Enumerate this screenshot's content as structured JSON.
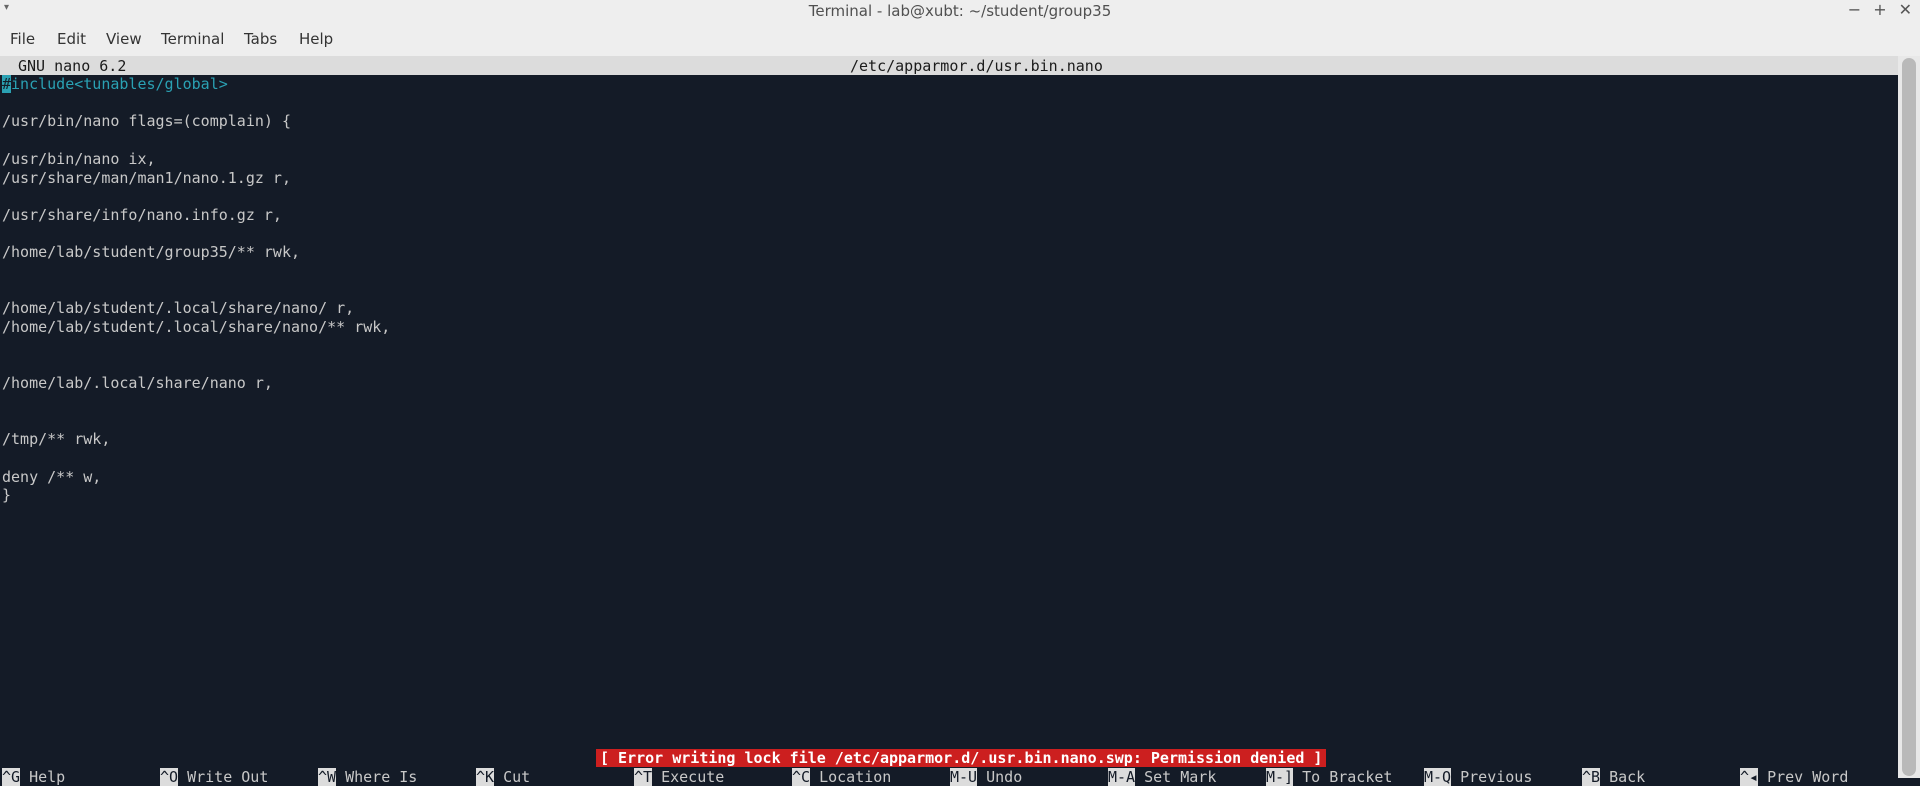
{
  "window": {
    "title": "Terminal - lab@xubt: ~/student/group35",
    "controls": [
      "minimize-icon",
      "maximize-icon",
      "close-icon"
    ]
  },
  "menubar": [
    "File",
    "Edit",
    "View",
    "Terminal",
    "Tabs",
    "Help"
  ],
  "nano": {
    "version": "GNU nano 6.2",
    "filename": "/etc/apparmor.d/usr.bin.nano",
    "status": "[ Error writing lock file /etc/apparmor.d/.usr.bin.nano.swp: Permission denied ]"
  },
  "lines": [
    {
      "text": "#include<tunables/global>",
      "highlight": true
    },
    {
      "text": ""
    },
    {
      "text": "/usr/bin/nano flags=(complain) {"
    },
    {
      "text": ""
    },
    {
      "text": "/usr/bin/nano ix,"
    },
    {
      "text": "/usr/share/man/man1/nano.1.gz r,"
    },
    {
      "text": ""
    },
    {
      "text": "/usr/share/info/nano.info.gz r,"
    },
    {
      "text": ""
    },
    {
      "text": "/home/lab/student/group35/** rwk,"
    },
    {
      "text": ""
    },
    {
      "text": ""
    },
    {
      "text": "/home/lab/student/.local/share/nano/ r,"
    },
    {
      "text": "/home/lab/student/.local/share/nano/** rwk,"
    },
    {
      "text": ""
    },
    {
      "text": ""
    },
    {
      "text": "/home/lab/.local/share/nano r,"
    },
    {
      "text": ""
    },
    {
      "text": ""
    },
    {
      "text": "/tmp/** rwk,"
    },
    {
      "text": ""
    },
    {
      "text": "deny /** w,"
    },
    {
      "text": "}"
    }
  ],
  "shortcuts": [
    {
      "key": "^G",
      "label": "Help"
    },
    {
      "key": "^O",
      "label": "Write Out"
    },
    {
      "key": "^W",
      "label": "Where Is"
    },
    {
      "key": "^K",
      "label": "Cut"
    },
    {
      "key": "^T",
      "label": "Execute"
    },
    {
      "key": "^C",
      "label": "Location"
    },
    {
      "key": "M-U",
      "label": "Undo"
    },
    {
      "key": "M-A",
      "label": "Set Mark"
    },
    {
      "key": "M-]",
      "label": "To Bracket"
    },
    {
      "key": "M-Q",
      "label": "Previous"
    },
    {
      "key": "^B",
      "label": "Back"
    },
    {
      "key": "^◂",
      "label": "Prev Word"
    }
  ]
}
